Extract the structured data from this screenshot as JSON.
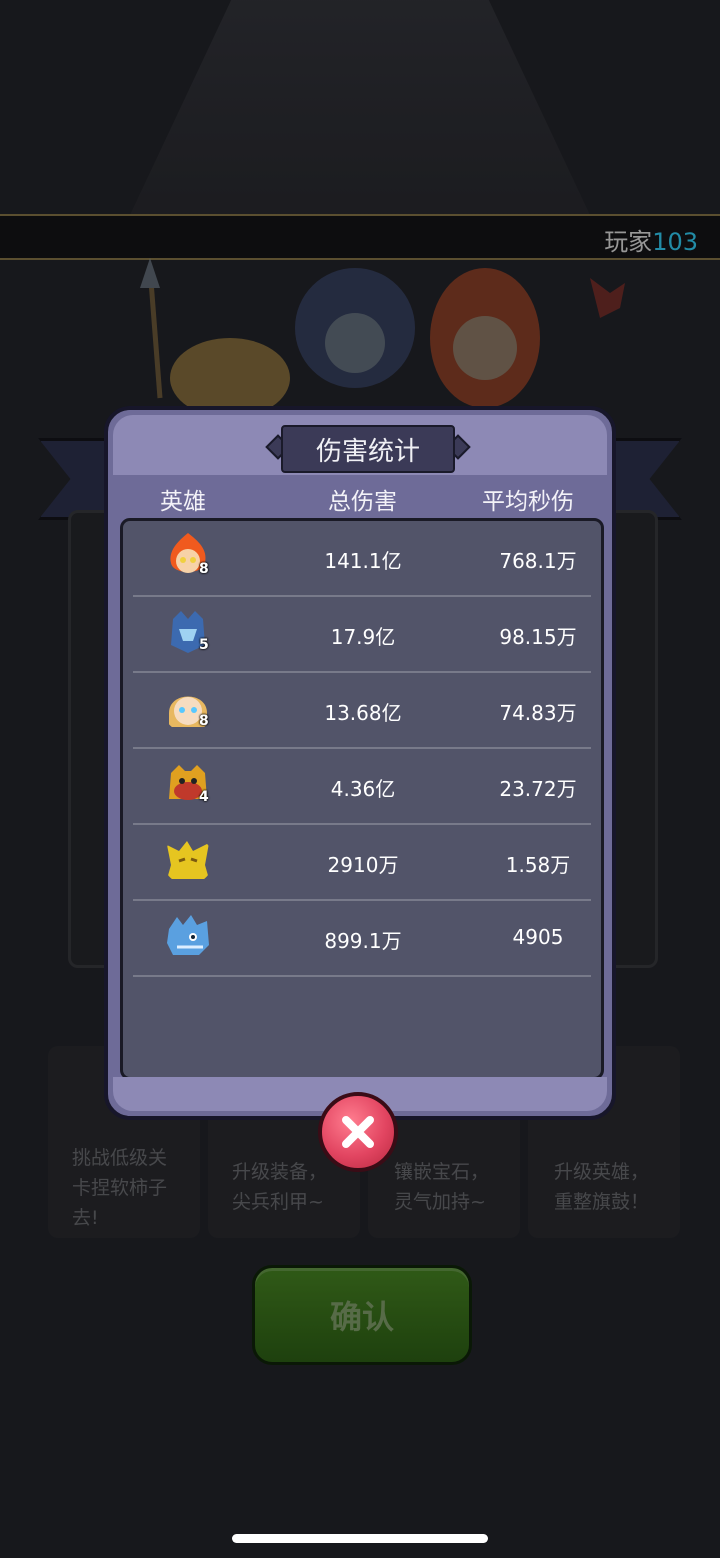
{
  "player": {
    "prefix": "玩家",
    "number": "103"
  },
  "tips": [
    {
      "text": "挑战低级关卡捏软柿子去!"
    },
    {
      "text": "升级装备，尖兵利甲~"
    },
    {
      "text": "镶嵌宝石，灵气加持~"
    },
    {
      "text": "升级英雄，重整旗鼓！"
    }
  ],
  "confirm_label": "确认",
  "modal": {
    "title": "伤害统计",
    "columns": {
      "hero": "英雄",
      "total": "总伤害",
      "dps": "平均秒伤"
    },
    "rows": [
      {
        "hero_icon": "fire-hero-icon",
        "level": "8",
        "total": "141.1亿",
        "dps": "768.1万"
      },
      {
        "hero_icon": "ice-knight-hero-icon",
        "level": "5",
        "total": "17.9亿",
        "dps": "98.15万"
      },
      {
        "hero_icon": "blonde-hero-icon",
        "level": "8",
        "total": "13.68亿",
        "dps": "74.83万"
      },
      {
        "hero_icon": "warrior-hero-icon",
        "level": "4",
        "total": "4.36亿",
        "dps": "23.72万"
      },
      {
        "hero_icon": "gold-dragon-icon",
        "level": "",
        "total": "2910万",
        "dps": "1.58万"
      },
      {
        "hero_icon": "blue-dragon-icon",
        "level": "",
        "total": "899.1万",
        "dps": "4905"
      }
    ]
  },
  "colors": {
    "accent_cyan": "#35d6ff",
    "modal_bg": "#6e6b98",
    "close_red": "#e24561",
    "confirm_green": "#3d7a1e"
  }
}
